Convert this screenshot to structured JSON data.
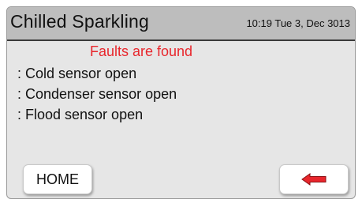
{
  "header": {
    "title": "Chilled Sparkling",
    "datetime": "10:19 Tue 3, Dec 3013"
  },
  "main": {
    "headline": "Faults are found",
    "faults": [
      ": Cold sensor open",
      ": Condenser sensor open",
      ": Flood sensor open"
    ]
  },
  "buttons": {
    "home_label": "HOME",
    "back_icon": "left-arrow-icon"
  },
  "colors": {
    "alert_text": "#e8262c",
    "back_arrow": "#e8262c",
    "header_bg": "#bdbdbd",
    "screen_bg": "#e6e6e6"
  }
}
